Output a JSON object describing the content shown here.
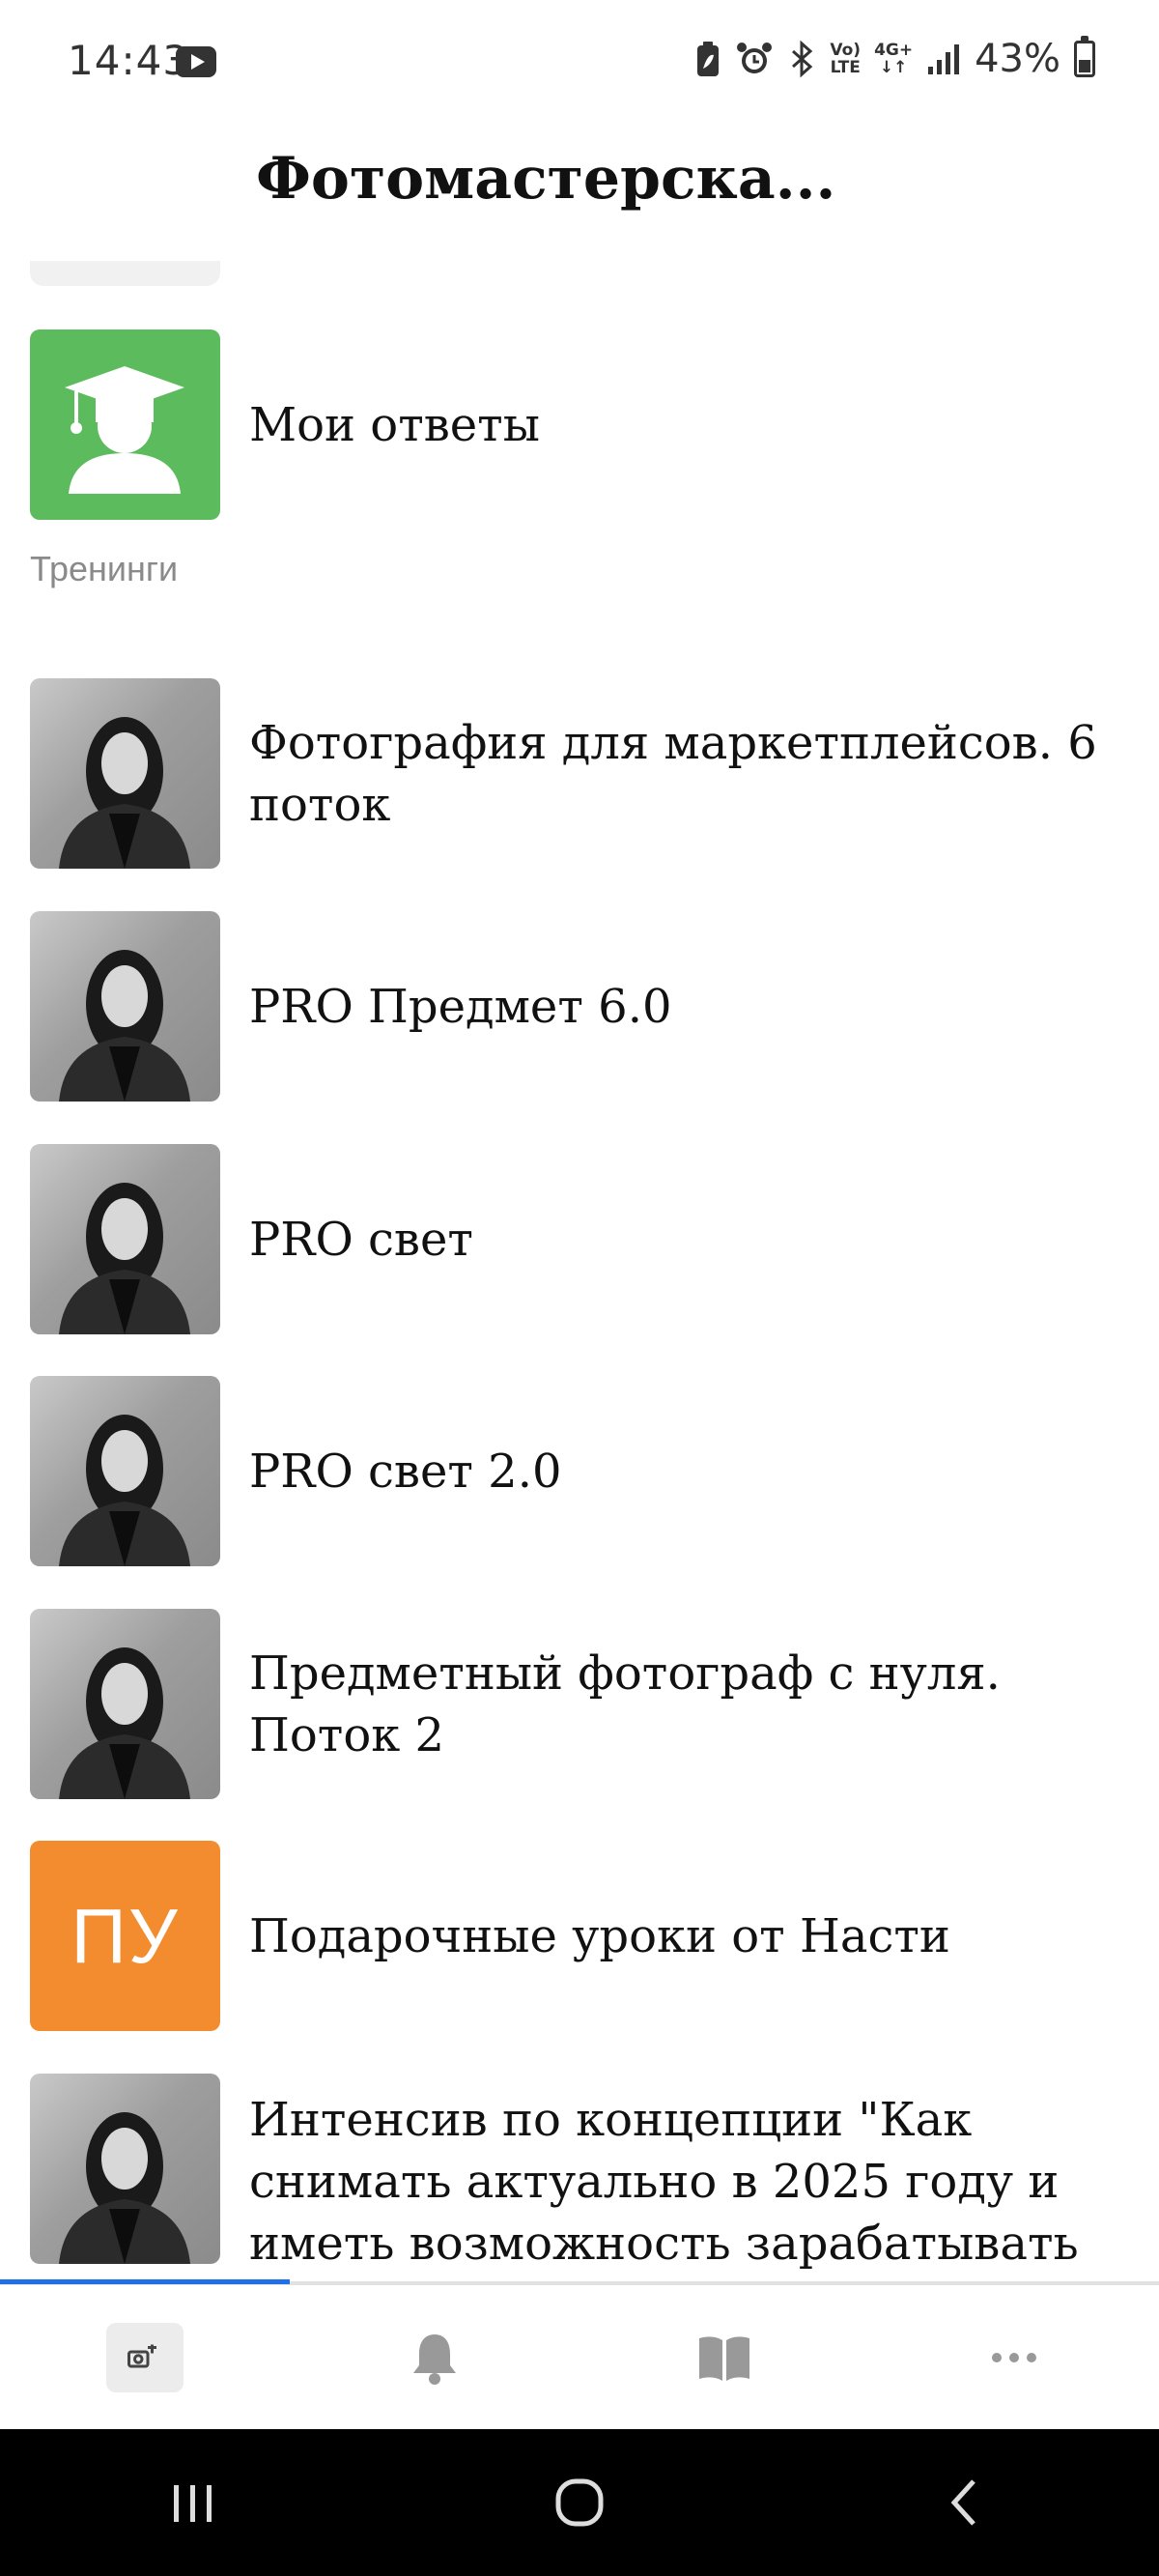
{
  "status_bar": {
    "time": "14:43",
    "battery_percent": "43%",
    "volte_top": "Vo)",
    "volte_bottom": "LTE",
    "network_top": "4G+",
    "network_bottom": "↓↑"
  },
  "header": {
    "title": "Фотомастерска..."
  },
  "list": {
    "my_answers": {
      "label": "Мои ответы"
    },
    "section_trainings": "Тренинги",
    "trainings": [
      {
        "label": "Фотография для маркетплейсов. 6 поток"
      },
      {
        "label": "PRO Предмет 6.0"
      },
      {
        "label": "PRO свет"
      },
      {
        "label": "PRO свет 2.0"
      },
      {
        "label": "Предметный фотограф с нуля. Поток 2"
      },
      {
        "label": "Подарочные уроки от Насти",
        "initials": "ПУ"
      },
      {
        "label": "Интенсив по концепции \"Как снимать актуально в 2025 году и иметь возможность зарабатывать на съемка..."
      }
    ]
  },
  "bottom_nav": {
    "progress": 0.25,
    "items": [
      "home",
      "notifications",
      "library",
      "more"
    ]
  },
  "colors": {
    "green_tile": "#5cbb5c",
    "orange_tile": "#f28c2e",
    "accent_blue": "#1e6fe8",
    "section_gray": "#8a8a8a"
  },
  "icons": {
    "my_answers": "graduate-icon",
    "nav": [
      "home-icon",
      "bell-icon",
      "book-icon",
      "more-icon"
    ],
    "system": [
      "recents-icon",
      "home-circle-icon",
      "back-icon"
    ]
  }
}
